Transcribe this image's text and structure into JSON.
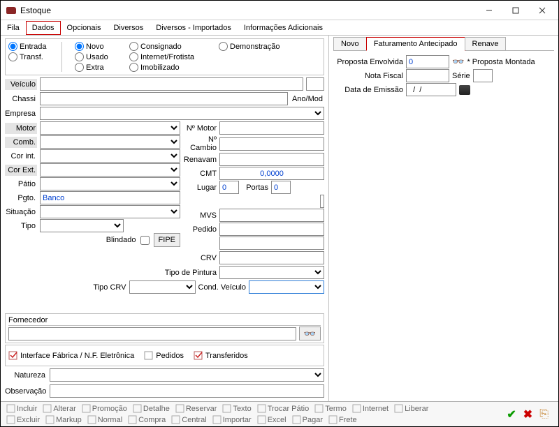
{
  "window": {
    "title": "Estoque"
  },
  "menubar": {
    "items": [
      "Fila",
      "Dados",
      "Opcionais",
      "Diversos",
      "Diversos - Importados",
      "Informações Adicionais"
    ],
    "active_index": 1
  },
  "radios": {
    "col1": {
      "entrada": "Entrada",
      "transf": "Transf."
    },
    "col2": {
      "novo": "Novo",
      "usado": "Usado",
      "extra": "Extra"
    },
    "col3": {
      "consignado": "Consignado",
      "internet": "Internet/Frotista",
      "imobilizado": "Imobilizado"
    },
    "col4": {
      "demo": "Demonstração"
    }
  },
  "labels": {
    "veiculo": "Veículo",
    "chassi": "Chassi",
    "anomod": "Ano/Mod",
    "empresa": "Empresa",
    "motor": "Motor",
    "comb": "Comb.",
    "corint": "Cor int.",
    "corext": "Cor Ext.",
    "patio": "Pátio",
    "pgto": "Pgto.",
    "situacao": "Situação",
    "tipo": "Tipo",
    "blindado": "Blindado",
    "fipe": "FIPE",
    "nmotor": "Nº Motor",
    "ncambio": "Nº Cambio",
    "renavam": "Renavam",
    "cmt": "CMT",
    "lugar": "Lugar",
    "portas": "Portas",
    "mvs": "MVS",
    "pedido": "Pedido",
    "crv": "CRV",
    "tipopintura": "Tipo de Pintura",
    "tipocrv": "Tipo CRV",
    "condveiculo": "Cond. Veículo",
    "fornecedor": "Fornecedor",
    "interf": "Interface Fábrica / N.F. Eletrônica",
    "pedidos": "Pedidos",
    "transferidos": "Transferidos",
    "natureza": "Natureza",
    "observacao": "Observação"
  },
  "values": {
    "pgto": "Banco",
    "cmt": "0,0000",
    "lugar": "0",
    "portas": "0"
  },
  "right": {
    "tabs": [
      "Novo",
      "Faturamento Antecipado",
      "Renave"
    ],
    "active_index": 1,
    "labels": {
      "proposta": "Proposta Envolvida",
      "montada": "* Proposta Montada",
      "nf": "Nota Fiscal",
      "serie": "Série",
      "dataemissao": "Data de Emissão"
    },
    "values": {
      "proposta": "0",
      "data": "  /  /    "
    }
  },
  "toolbar": {
    "row1": [
      "Incluir",
      "Alterar",
      "Promoção",
      "Detalhe",
      "Reservar",
      "Texto",
      "Trocar Pátio",
      "Termo",
      "Internet",
      "Liberar"
    ],
    "row2": [
      "Excluir",
      "Markup",
      "Normal",
      "Compra",
      "Central",
      "Importar",
      "Excel",
      "Pagar",
      "Frete"
    ]
  }
}
